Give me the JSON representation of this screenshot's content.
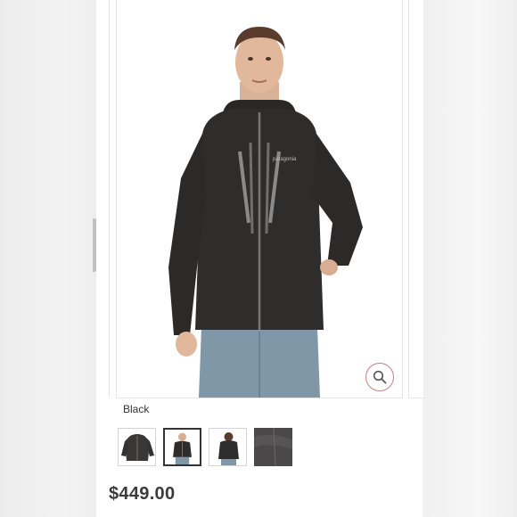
{
  "product": {
    "image_alt": "Man wearing black hooded rain jacket",
    "logo_text": "patagonia",
    "color_label": "Black",
    "price": "$449.00"
  },
  "gallery": {
    "thumbnails": [
      {
        "name": "jacket-flat",
        "selected": false
      },
      {
        "name": "model-front",
        "selected": true
      },
      {
        "name": "model-back",
        "selected": false
      },
      {
        "name": "fabric-swatch",
        "selected": false
      }
    ]
  },
  "colors": {
    "jacket": "#2f2c2c",
    "zoom_ring": "#c98080",
    "price_text": "#3b3b3b"
  },
  "icons": {
    "zoom": "magnifier-icon"
  }
}
